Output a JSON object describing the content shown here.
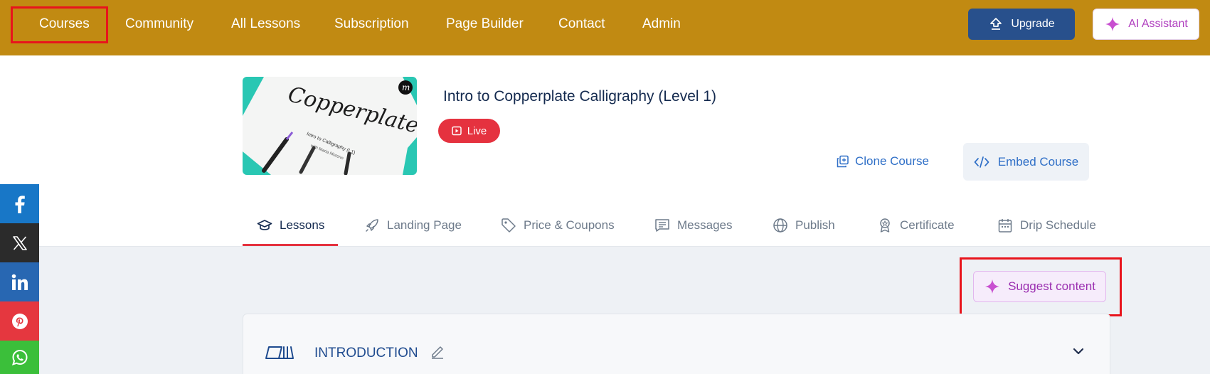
{
  "nav": {
    "items": [
      "Courses",
      "Community",
      "All Lessons",
      "Subscription",
      "Page Builder",
      "Contact",
      "Admin"
    ],
    "upgrade_label": "Upgrade",
    "ai_label": "AI Assistant"
  },
  "course": {
    "title": "Intro to Copperplate Calligraphy (Level 1)",
    "status": "Live",
    "thumbnail_text": {
      "script": "Copperplate",
      "sub": "Intro to Calligraphy (L1)",
      "author": "with Maria Moreno"
    }
  },
  "actions": {
    "clone_label": "Clone Course",
    "embed_label": "Embed Course"
  },
  "tabs": [
    "Lessons",
    "Landing Page",
    "Price & Coupons",
    "Messages",
    "Publish",
    "Certificate",
    "Drip Schedule"
  ],
  "active_tab": "Lessons",
  "content": {
    "suggest_label": "Suggest content",
    "section_title": "INTRODUCTION"
  },
  "social": [
    "facebook",
    "x",
    "linkedin",
    "pinterest",
    "whatsapp"
  ],
  "colors": {
    "nav_bg": "#c18a12",
    "upgrade_bg": "#28508c",
    "live_badge": "#e5323f",
    "highlight_box": "#e8141c",
    "ai_accent": "#b03fbf",
    "facebook": "#1877c7",
    "x": "#2b2b2b",
    "linkedin": "#2867b2",
    "pinterest": "#e5373f",
    "whatsapp": "#3bbf3a"
  }
}
